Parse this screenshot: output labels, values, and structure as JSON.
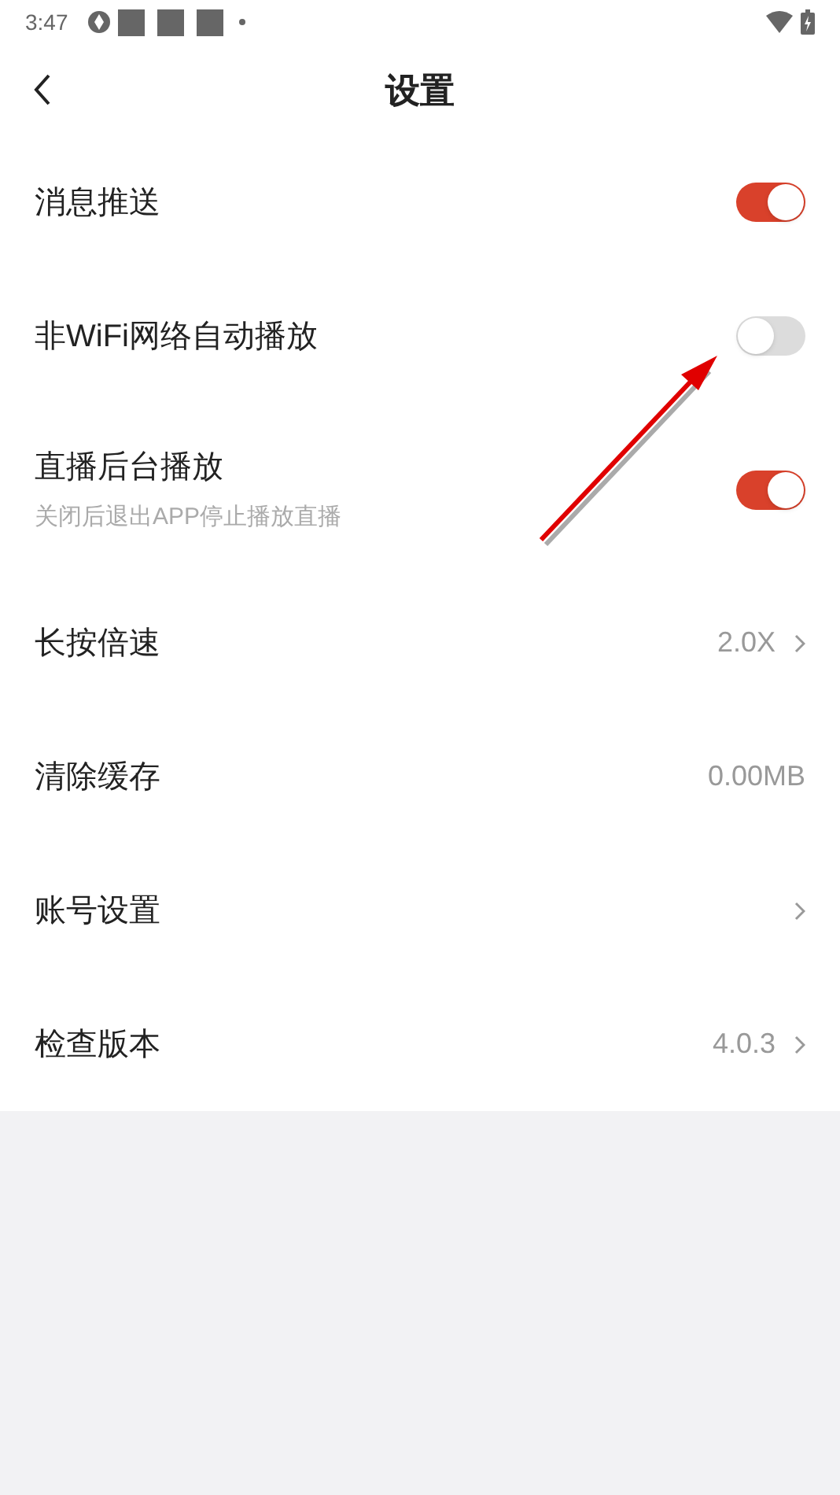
{
  "status_bar": {
    "time": "3:47"
  },
  "header": {
    "title": "设置"
  },
  "settings": [
    {
      "kind": "toggle",
      "label": "消息推送",
      "on": true
    },
    {
      "kind": "toggle",
      "label": "非WiFi网络自动播放",
      "on": false
    },
    {
      "kind": "toggle",
      "label": "直播后台播放",
      "subtitle": "关闭后退出APP停止播放直播",
      "on": true
    },
    {
      "kind": "link",
      "label": "长按倍速",
      "value": "2.0X"
    },
    {
      "kind": "value",
      "label": "清除缓存",
      "value": "0.00MB"
    },
    {
      "kind": "link",
      "label": "账号设置"
    },
    {
      "kind": "link",
      "label": "检查版本",
      "value": "4.0.3"
    }
  ]
}
